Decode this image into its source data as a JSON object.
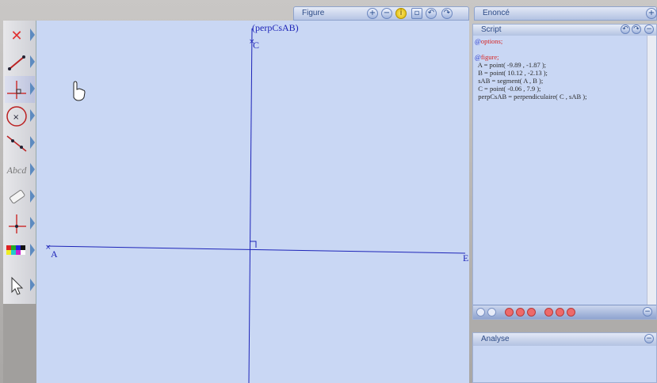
{
  "figure_panel": {
    "title": "Figure"
  },
  "enonce_panel": {
    "title": "Enoncé"
  },
  "script_panel": {
    "title": "Script",
    "lines": [
      {
        "prefix": "@",
        "text": "options;"
      },
      {
        "prefix": "",
        "text": ""
      },
      {
        "prefix": "@",
        "text": "figure;"
      },
      {
        "prefix": "",
        "text": "  A = point( -9.89 , -1.87 );"
      },
      {
        "prefix": "",
        "text": "  B = point( 10.12 , -2.13 );"
      },
      {
        "prefix": "",
        "text": "  sAB = segment( A , B );"
      },
      {
        "prefix": "",
        "text": "  C = point( -0.06 , 7.9 );"
      },
      {
        "prefix": "",
        "text": "  perpCsAB = perpendiculaire( C , sAB );"
      }
    ]
  },
  "analyse_panel": {
    "title": "Analyse"
  },
  "figure": {
    "labels": {
      "point_a": "A",
      "point_b": "E",
      "point_c": "C",
      "line_perp": "(perpCsAB)"
    }
  },
  "toolbar": {
    "tools": [
      {
        "name": "delete-tool",
        "icon": "red-x-icon"
      },
      {
        "name": "segment-tool",
        "icon": "segment-icon"
      },
      {
        "name": "perpendicular-tool",
        "icon": "perpendicular-icon"
      },
      {
        "name": "circle-tool",
        "icon": "circle-icon"
      },
      {
        "name": "line-tool",
        "icon": "line-icon"
      },
      {
        "name": "text-tool",
        "icon": "text-icon",
        "label": "Abcd"
      },
      {
        "name": "eraser-tool",
        "icon": "eraser-icon"
      },
      {
        "name": "point-tool",
        "icon": "point-icon"
      },
      {
        "name": "color-tool",
        "icon": "palette-icon"
      },
      {
        "name": "select-tool",
        "icon": "pointer-icon"
      }
    ]
  },
  "colors": {
    "canvas": "#c9d7f4",
    "geometry": "#1d24b8",
    "accent": "#5d8bc0"
  }
}
